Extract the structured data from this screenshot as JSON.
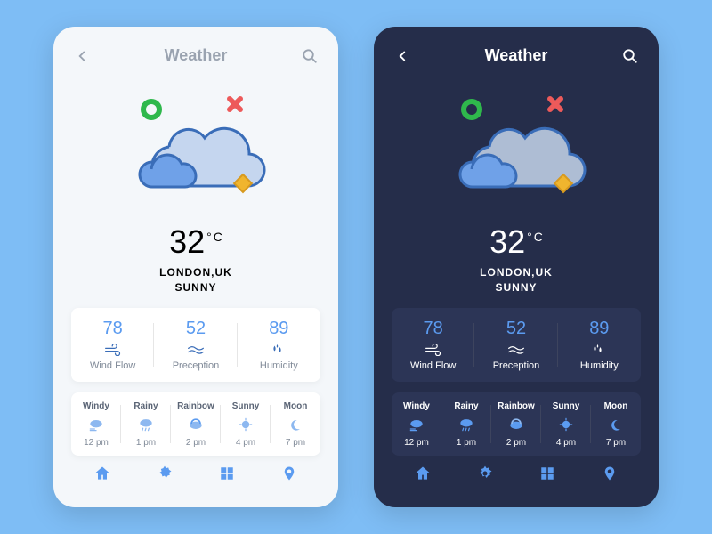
{
  "header": {
    "title": "Weather"
  },
  "temp": {
    "value": "32",
    "unit": "C"
  },
  "location": "LONDON,UK",
  "condition": "SUNNY",
  "stats": [
    {
      "value": "78",
      "label": "Wind Flow"
    },
    {
      "value": "52",
      "label": "Preception"
    },
    {
      "value": "89",
      "label": "Humidity"
    }
  ],
  "forecast": [
    {
      "name": "Windy",
      "time": "12 pm"
    },
    {
      "name": "Rainy",
      "time": "1 pm"
    },
    {
      "name": "Rainbow",
      "time": "2 pm"
    },
    {
      "name": "Sunny",
      "time": "4 pm"
    },
    {
      "name": "Moon",
      "time": "7 pm"
    }
  ],
  "colors": {
    "accent": "#5b9bf0",
    "green": "#2fb84c",
    "red": "#ed5a5a",
    "yellow": "#f0b52e"
  }
}
